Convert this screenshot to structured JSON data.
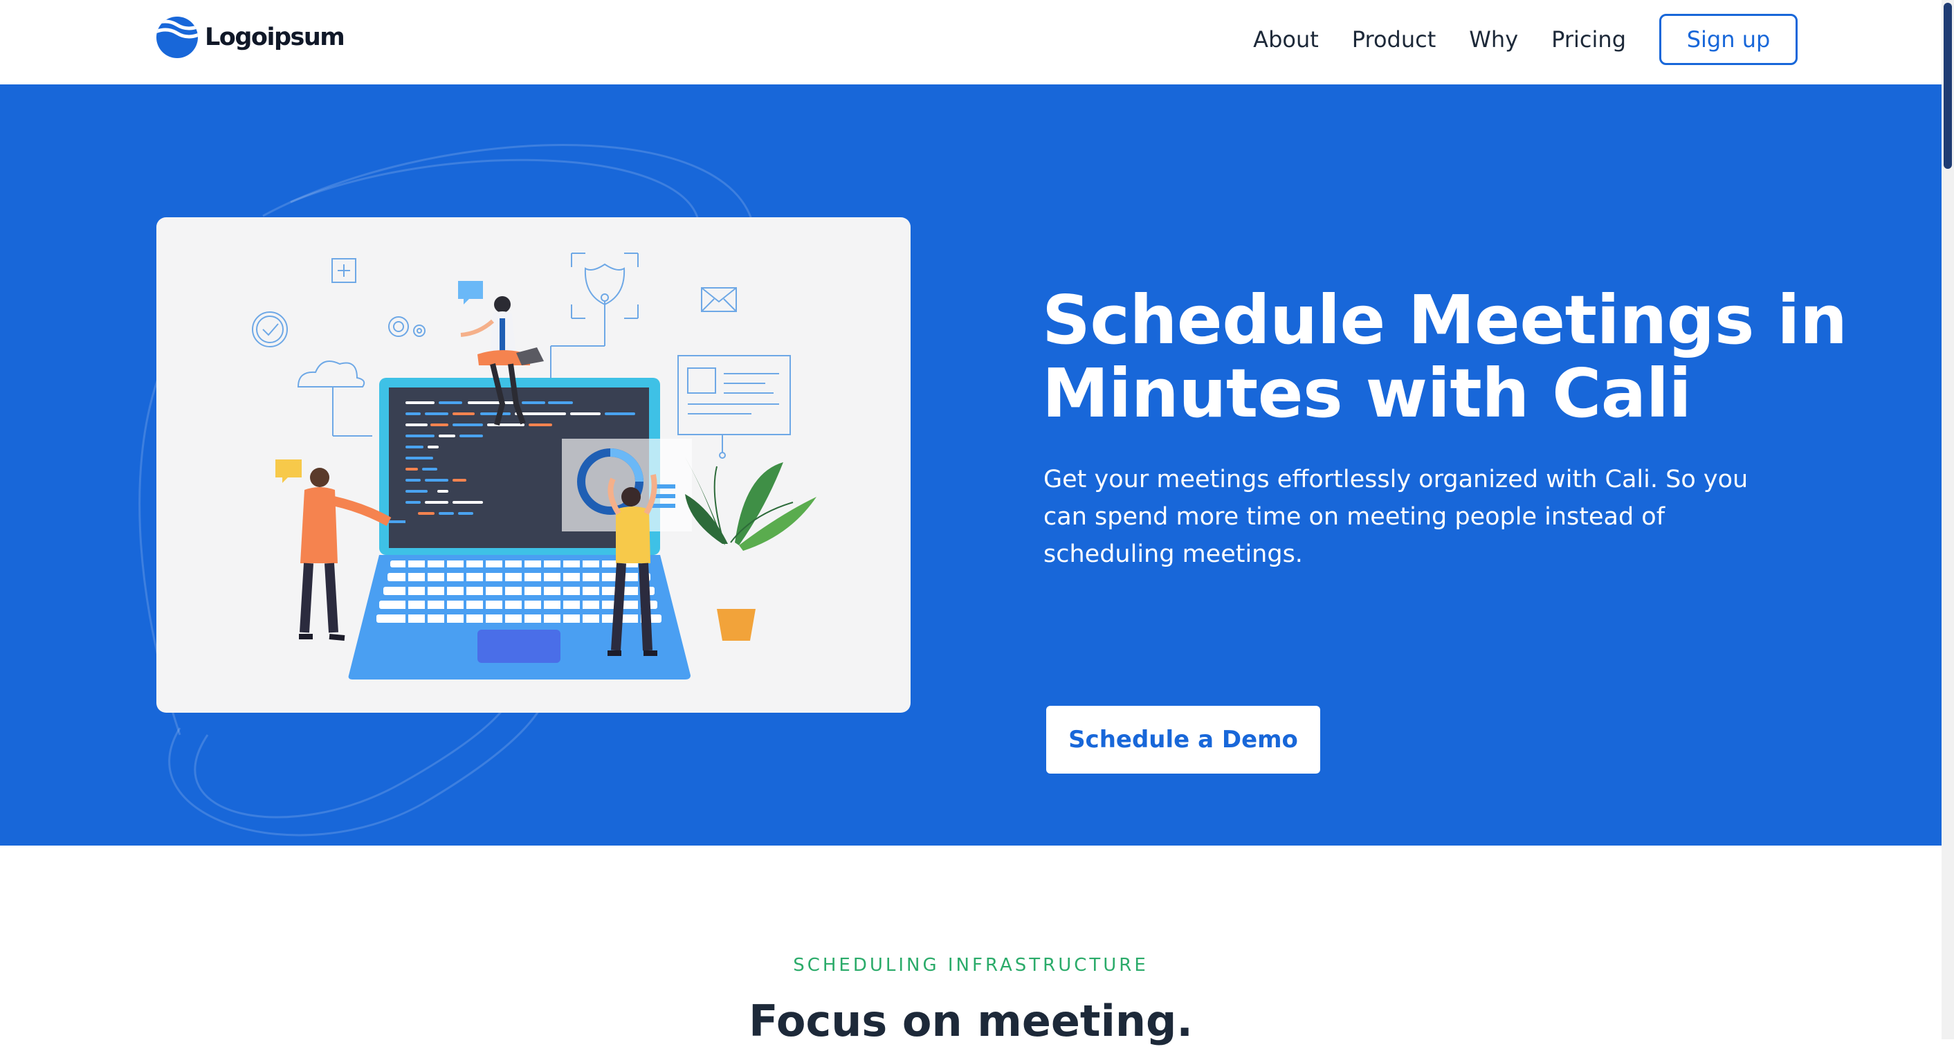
{
  "header": {
    "logo_text": "Logoipsum",
    "nav": [
      {
        "label": "About"
      },
      {
        "label": "Product"
      },
      {
        "label": "Why"
      },
      {
        "label": "Pricing"
      }
    ],
    "signup_label": "Sign up"
  },
  "hero": {
    "title": "Schedule Meetings in Minutes with Cali",
    "subtitle": "Get your meetings effortlessly organized with Cali. So you can spend more time on meeting people instead of scheduling meetings.",
    "cta_label": "Schedule a Demo"
  },
  "section": {
    "eyebrow": "SCHEDULING INFRASTRUCTURE",
    "heading": "Focus on meeting."
  },
  "icons": [
    "logo-mark-icon",
    "shield-icon",
    "mail-icon",
    "cloud-icon",
    "check-circle-icon",
    "gear-icon",
    "plus-icon",
    "chat-bubble-icon",
    "donut-chart-icon"
  ],
  "colors": {
    "primary": "#1867d9",
    "header_bg": "#ffffff",
    "text_dark": "#1d2939",
    "eyebrow": "#2bab6a",
    "illustration_bg": "#f4f4f5"
  }
}
